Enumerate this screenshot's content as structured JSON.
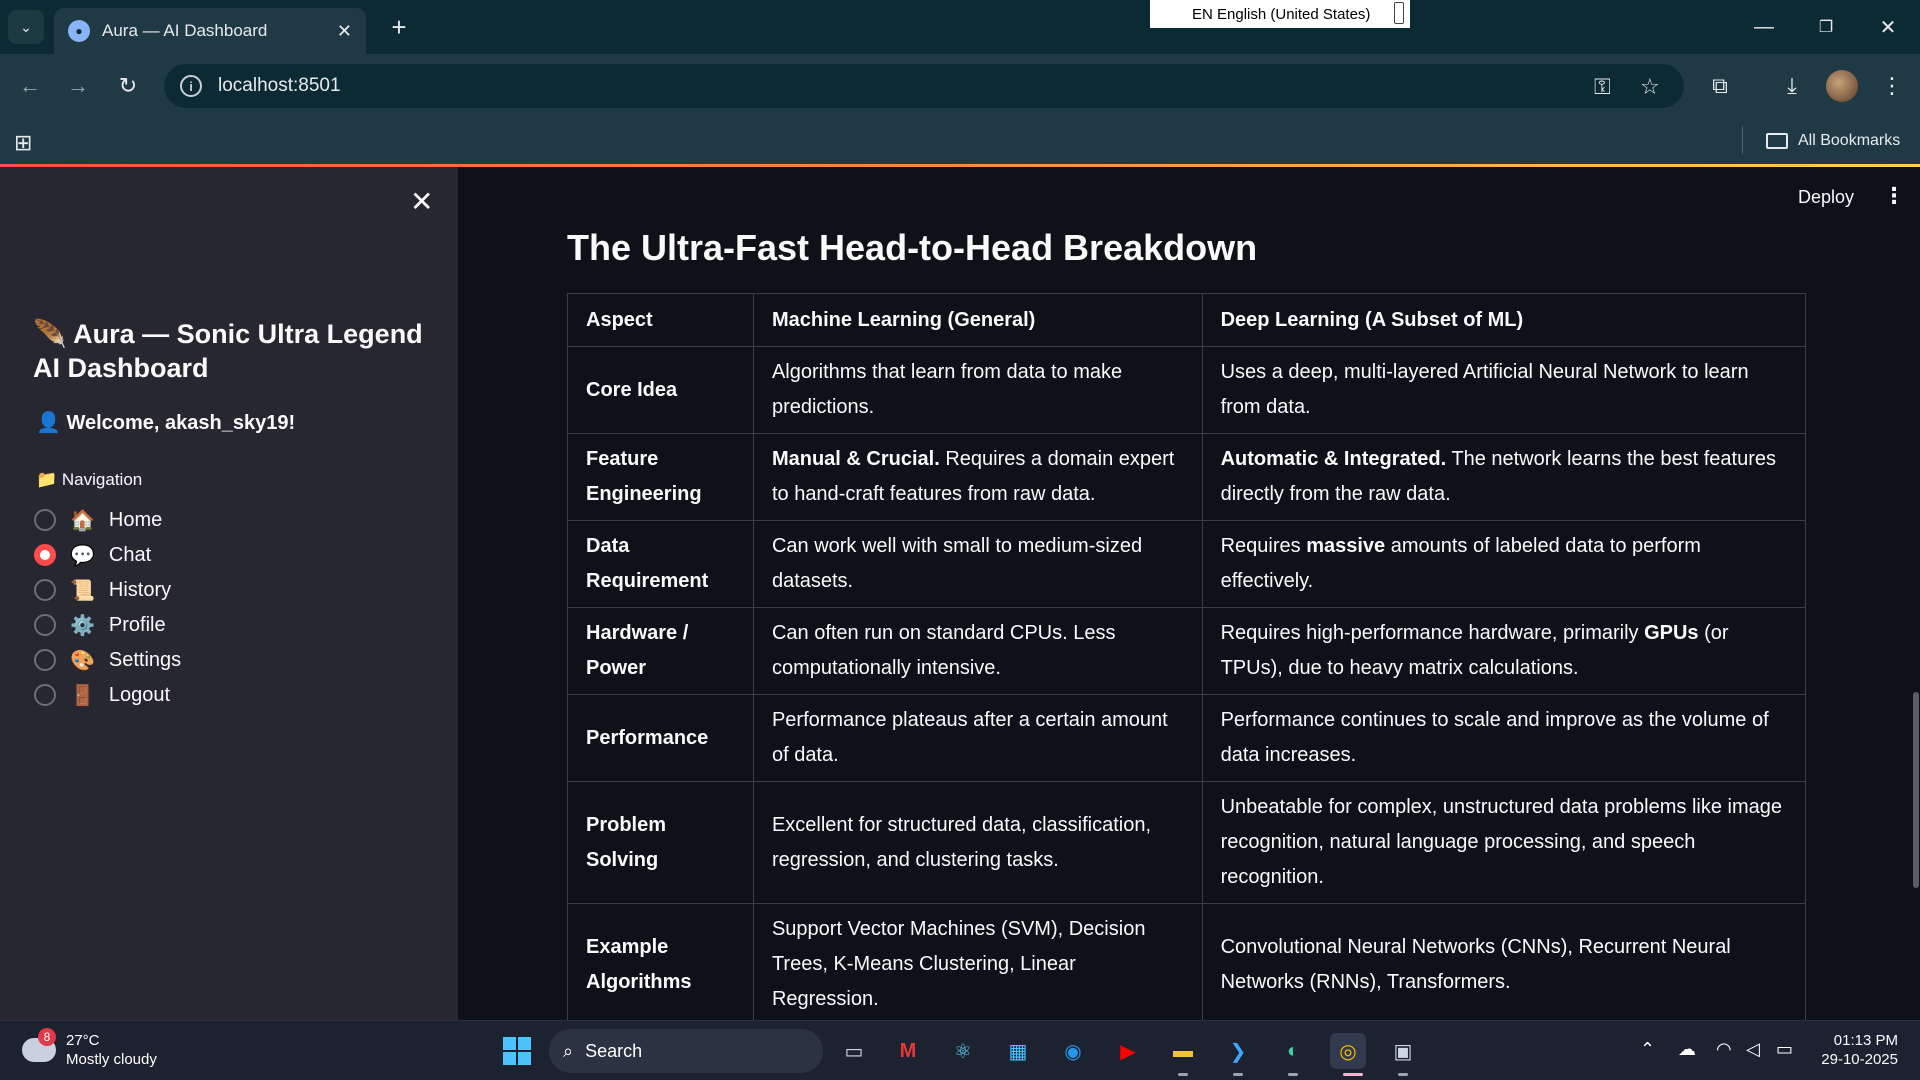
{
  "browser": {
    "tab_title": "Aura — AI Dashboard",
    "url": "localhost:8501",
    "language_popup": "EN English (United States)",
    "all_bookmarks": "All Bookmarks"
  },
  "sidebar": {
    "app_title_icon": "🪶",
    "app_title": "Aura — Sonic Ultra Legend AI Dashboard",
    "welcome_icon": "👤",
    "welcome": "Welcome, akash_sky19!",
    "nav_icon": "📁",
    "nav_header": "Navigation",
    "items": [
      {
        "icon": "🏠",
        "label": "Home",
        "selected": false
      },
      {
        "icon": "💬",
        "label": "Chat",
        "selected": true
      },
      {
        "icon": "📜",
        "label": "History",
        "selected": false
      },
      {
        "icon": "⚙️",
        "label": "Profile",
        "selected": false
      },
      {
        "icon": "🎨",
        "label": "Settings",
        "selected": false
      },
      {
        "icon": "🚪",
        "label": "Logout",
        "selected": false
      }
    ]
  },
  "main": {
    "deploy_label": "Deploy",
    "heading": "The Ultra-Fast Head-to-Head Breakdown",
    "table": {
      "headers": [
        "Aspect",
        "Machine Learning (General)",
        "Deep Learning (A Subset of ML)"
      ],
      "rows": [
        {
          "aspect": "Core Idea",
          "ml": {
            "bold": "",
            "text": "Algorithms that learn from data to make predictions."
          },
          "dl": {
            "pre": "Uses a deep, multi-layered Artificial Neural Network to learn from data.",
            "bold": "",
            "post": ""
          }
        },
        {
          "aspect": "Feature Engineering",
          "ml": {
            "bold": "Manual & Crucial.",
            "text": " Requires a domain expert to hand-craft features from raw data."
          },
          "dl": {
            "pre": "",
            "bold": "Automatic & Integrated.",
            "post": " The network learns the best features directly from the raw data."
          }
        },
        {
          "aspect": "Data Requirement",
          "ml": {
            "bold": "",
            "text": "Can work well with small to medium-sized datasets."
          },
          "dl": {
            "pre": "Requires ",
            "bold": "massive",
            "post": " amounts of labeled data to perform effectively."
          }
        },
        {
          "aspect": "Hardware / Power",
          "ml": {
            "bold": "",
            "text": "Can often run on standard CPUs. Less computationally intensive."
          },
          "dl": {
            "pre": "Requires high-performance hardware, primarily ",
            "bold": "GPUs",
            "post": " (or TPUs), due to heavy matrix calculations."
          }
        },
        {
          "aspect": "Performance",
          "ml": {
            "bold": "",
            "text": "Performance plateaus after a certain amount of data."
          },
          "dl": {
            "pre": "Performance continues to scale and improve as the volume of data increases.",
            "bold": "",
            "post": ""
          }
        },
        {
          "aspect": "Problem Solving",
          "ml": {
            "bold": "",
            "text": "Excellent for structured data, classification, regression, and clustering tasks."
          },
          "dl": {
            "pre": "Unbeatable for complex, unstructured data problems like image recognition, natural language processing, and speech recognition.",
            "bold": "",
            "post": ""
          }
        },
        {
          "aspect": "Example Algorithms",
          "ml": {
            "bold": "",
            "text": "Support Vector Machines (SVM), Decision Trees, K-Means Clustering, Linear Regression."
          },
          "dl": {
            "pre": "Convolutional Neural Networks (CNNs), Recurrent Neural Networks (RNNs), Transformers.",
            "bold": "",
            "post": ""
          }
        }
      ]
    }
  },
  "taskbar": {
    "weather_badge": "8",
    "temperature": "27°C",
    "weather_desc": "Mostly cloudy",
    "search_placeholder": "Search",
    "time": "01:13 PM",
    "date": "29-10-2025"
  },
  "colors": {
    "accent": "#ff4b4b",
    "sidebar_bg": "#262730",
    "main_bg": "#0e1117",
    "chrome_bg": "#1f3a44"
  }
}
